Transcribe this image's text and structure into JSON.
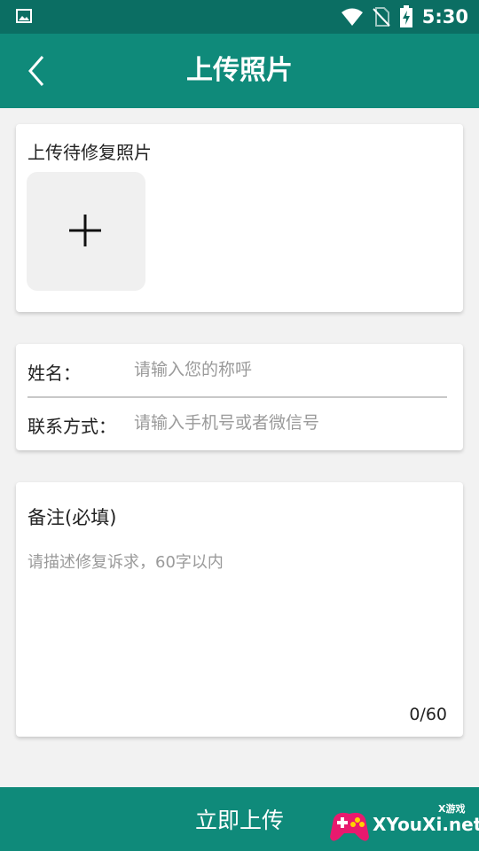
{
  "status_bar": {
    "time": "5:30",
    "icons": [
      "image-icon",
      "wifi-icon",
      "no-sim-icon",
      "battery-charging-icon"
    ]
  },
  "title_bar": {
    "back_icon": "chevron-left-icon",
    "title": "上传照片"
  },
  "photo_card": {
    "title": "上传待修复照片",
    "add_icon": "plus-icon"
  },
  "contact_card": {
    "name_label": "姓名：",
    "name_placeholder": "请输入您的称呼",
    "name_value": "",
    "phone_label": "联系方式：",
    "phone_placeholder": "请输入手机号或者微信号",
    "phone_value": ""
  },
  "note_card": {
    "title": "备注(必填)",
    "placeholder": "请描述修复诉求，60字以内",
    "value": "",
    "count": "0/60"
  },
  "submit_button": {
    "label": "立即上传"
  },
  "watermark": {
    "small_text": "X游戏",
    "text": "XYouXi.net"
  },
  "colors": {
    "status_bar": "#0b6e63",
    "accent": "#0f8a7a",
    "background": "#f2f2f2",
    "placeholder": "#9a9a9a"
  }
}
